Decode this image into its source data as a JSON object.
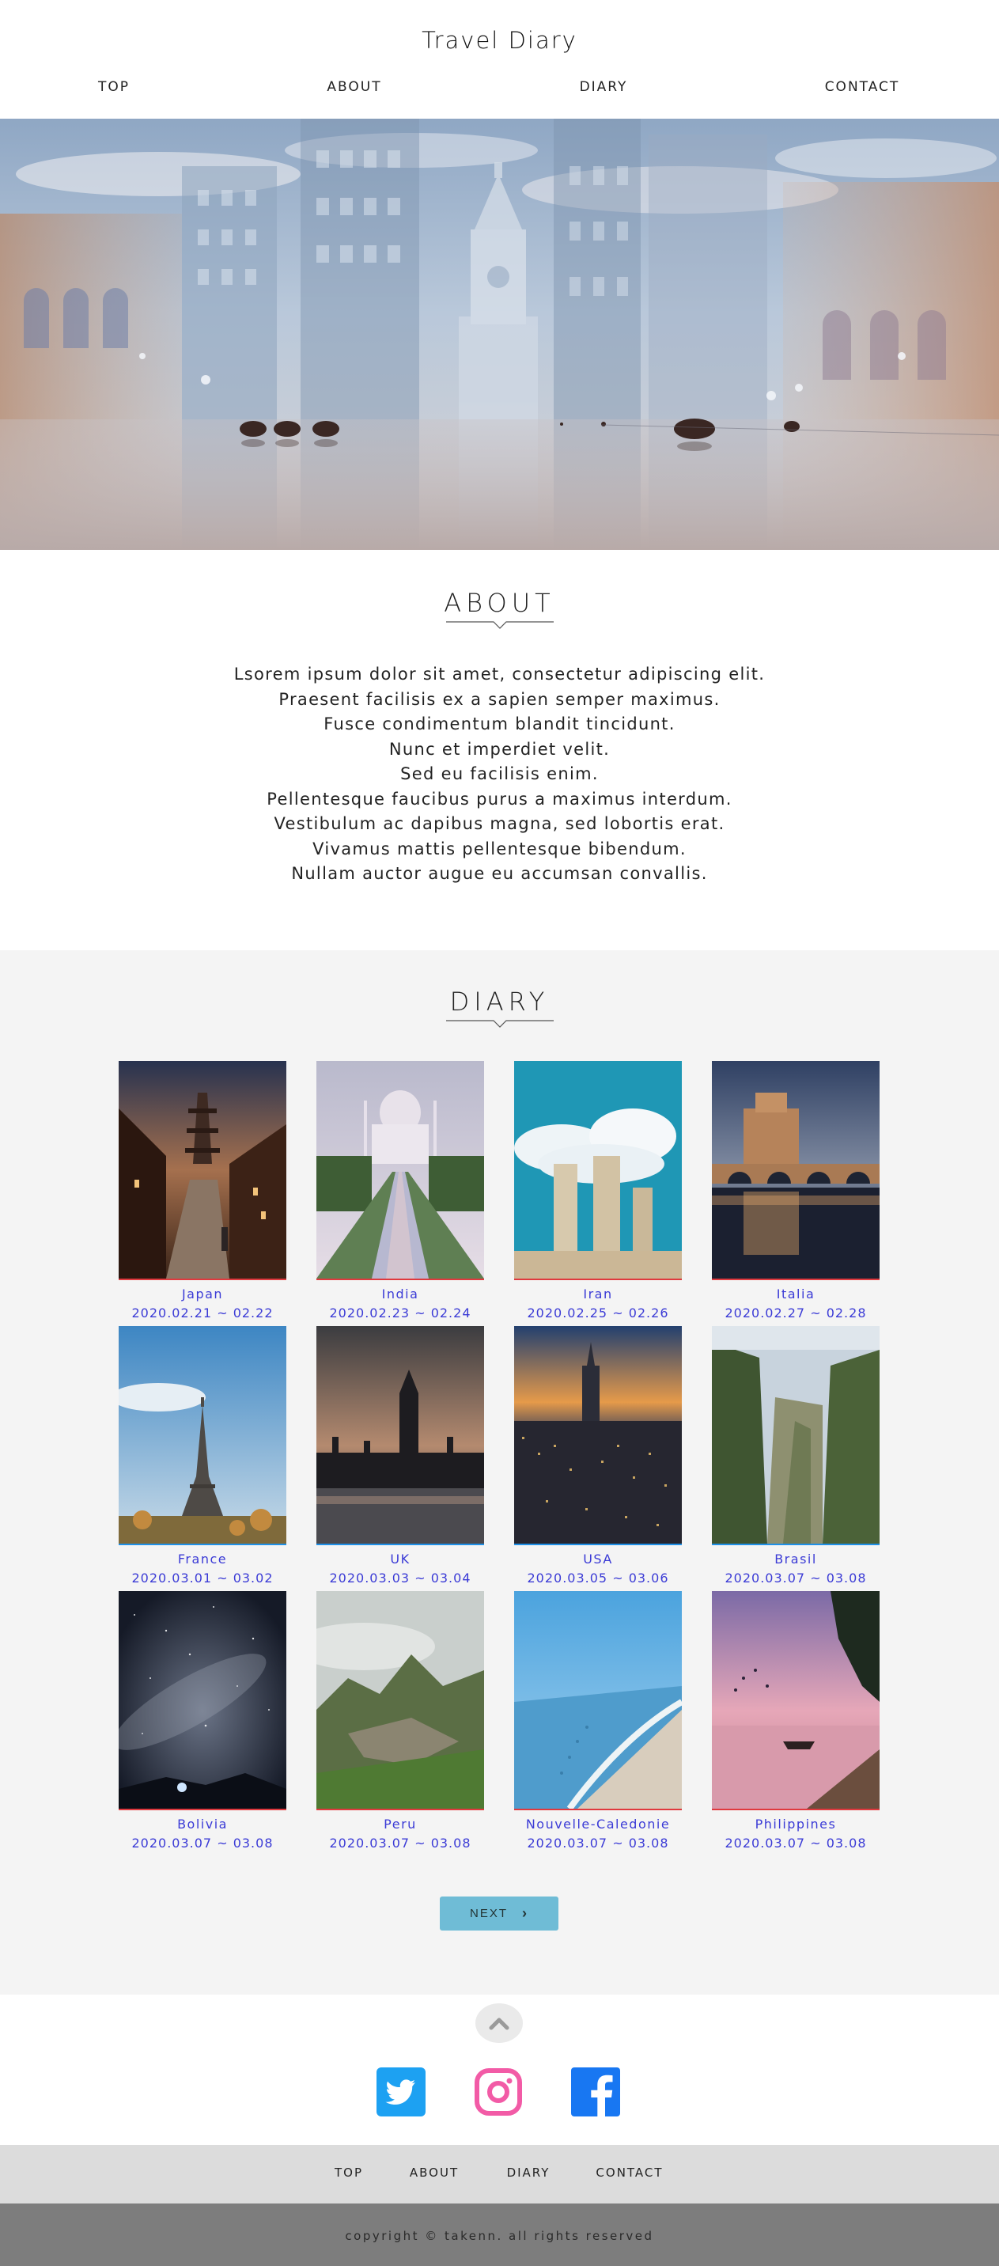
{
  "header": {
    "site_title": "Travel Diary",
    "nav": [
      "TOP",
      "ABOUT",
      "DIARY",
      "CONTACT"
    ]
  },
  "hero": {
    "image": "city-street-overlay"
  },
  "about": {
    "title": "ABOUT",
    "lines": [
      "Lsorem ipsum dolor sit amet, consectetur adipiscing elit.",
      "Praesent facilisis ex a sapien semper maximus.",
      "Fusce condimentum blandit tincidunt.",
      "Nunc et imperdiet velit.",
      "Sed eu facilisis enim.",
      "Pellentesque faucibus purus a maximus interdum.",
      "Vestibulum ac dapibus magna, sed lobortis erat.",
      "Vivamus mattis pellentesque bibendum.",
      "Nullam auctor augue eu accumsan convallis."
    ]
  },
  "diary": {
    "title": "DIARY",
    "entries": [
      {
        "place": "Japan",
        "date": "2020.02.21 ~ 02.22",
        "bar_color": "#e0393e"
      },
      {
        "place": "India",
        "date": "2020.02.23 ~ 02.24",
        "bar_color": "#e0393e"
      },
      {
        "place": "Iran",
        "date": "2020.02.25 ~ 02.26",
        "bar_color": "#e0393e"
      },
      {
        "place": "Italia",
        "date": "2020.02.27 ~ 02.28",
        "bar_color": "#e0393e"
      },
      {
        "place": "France",
        "date": "2020.03.01 ~ 03.02",
        "bar_color": "#1e90e8"
      },
      {
        "place": "UK",
        "date": "2020.03.03 ~ 03.04",
        "bar_color": "#1e90e8"
      },
      {
        "place": "USA",
        "date": "2020.03.05 ~ 03.06",
        "bar_color": "#1e90e8"
      },
      {
        "place": "Brasil",
        "date": "2020.03.07 ~ 03.08",
        "bar_color": "#1e90e8"
      },
      {
        "place": "Bolivia",
        "date": "2020.03.07 ~ 03.08",
        "bar_color": "#e0393e"
      },
      {
        "place": "Peru",
        "date": "2020.03.07 ~ 03.08",
        "bar_color": "#e0393e"
      },
      {
        "place": "Nouvelle-Caledonie",
        "date": "2020.03.07 ~ 03.08",
        "bar_color": "#e0393e"
      },
      {
        "place": "Philippines",
        "date": "2020.03.07 ~ 03.08",
        "bar_color": "#e0393e"
      }
    ],
    "next_label": "NEXT"
  },
  "social": {
    "icons": [
      "twitter-icon",
      "instagram-icon",
      "facebook-icon"
    ],
    "colors": {
      "twitter": "#1da1f2",
      "instagram": "#f25ba6",
      "facebook": "#1877f2"
    }
  },
  "footer": {
    "nav": [
      "TOP",
      "ABOUT",
      "DIARY",
      "CONTACT"
    ],
    "copyright": "copyright © takenn. all rights reserved"
  }
}
